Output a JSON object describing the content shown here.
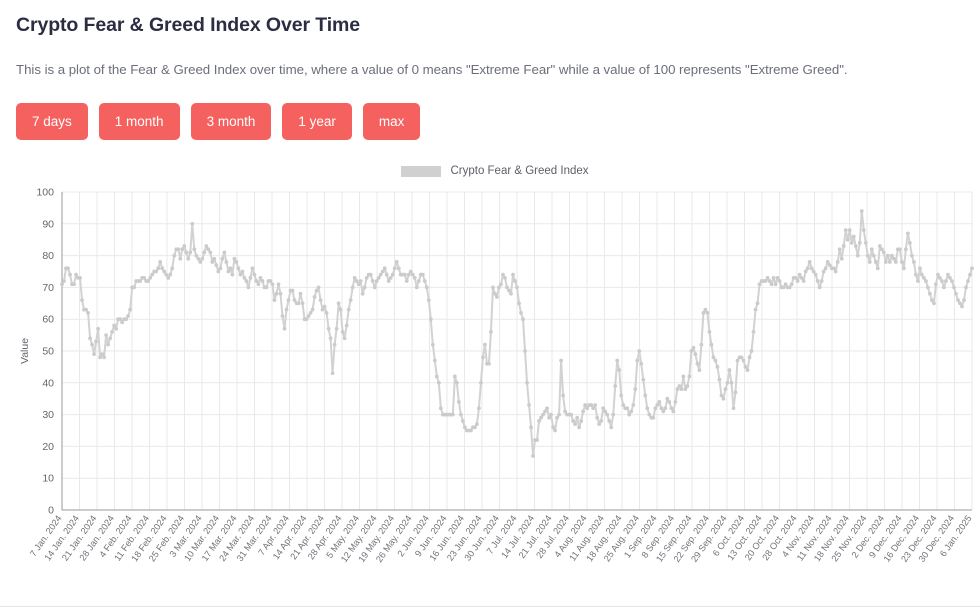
{
  "header": {
    "title": "Crypto Fear & Greed Index Over Time",
    "description": "This is a plot of the Fear & Greed Index over time, where a value of 0 means \"Extreme Fear\" while a value of 100 represents \"Extreme Greed\"."
  },
  "colors": {
    "button": "#f4615f",
    "button_text": "#ffffff",
    "series": "#d2d2d2",
    "grid": "#e9e9ea",
    "axis": "#9a9a9c",
    "title_text": "#2b2d42",
    "body_text": "#6b6f7b"
  },
  "range_buttons": [
    {
      "label": "7 days",
      "name": "range-7-days"
    },
    {
      "label": "1 month",
      "name": "range-1-month"
    },
    {
      "label": "3 month",
      "name": "range-3-month"
    },
    {
      "label": "1 year",
      "name": "range-1-year"
    },
    {
      "label": "max",
      "name": "range-max"
    }
  ],
  "chart_data": {
    "type": "line",
    "title": "",
    "xlabel": "",
    "ylabel": "Value",
    "ylim": [
      0,
      100
    ],
    "yticks": [
      0,
      10,
      20,
      30,
      40,
      50,
      60,
      70,
      80,
      90,
      100
    ],
    "grid": true,
    "legend": {
      "position": "top-center",
      "entries": [
        "Crypto Fear & Greed Index"
      ]
    },
    "series": [
      {
        "name": "Crypto Fear & Greed Index",
        "color": "#d2d2d2",
        "start_date": "7 Jan. 2024",
        "end_date": "6 Jan. 2025",
        "interval_days": 1,
        "values": [
          71,
          72,
          76,
          76,
          74,
          71,
          71,
          74,
          73,
          73,
          66,
          63,
          63,
          62,
          54,
          52,
          49,
          53,
          57,
          48,
          49,
          48,
          55,
          52,
          54,
          56,
          58,
          57,
          60,
          60,
          59,
          60,
          60,
          61,
          63,
          70,
          70,
          72,
          72,
          72,
          73,
          73,
          72,
          72,
          73,
          74,
          75,
          75,
          76,
          78,
          76,
          75,
          74,
          73,
          74,
          76,
          80,
          82,
          82,
          79,
          82,
          83,
          81,
          79,
          81,
          90,
          82,
          80,
          79,
          78,
          79,
          81,
          83,
          82,
          81,
          78,
          79,
          77,
          75,
          76,
          79,
          81,
          78,
          75,
          76,
          74,
          79,
          78,
          76,
          74,
          75,
          73,
          72,
          70,
          73,
          76,
          74,
          72,
          71,
          73,
          72,
          70,
          70,
          72,
          72,
          71,
          66,
          68,
          71,
          68,
          61,
          57,
          63,
          66,
          69,
          69,
          66,
          65,
          65,
          68,
          65,
          60,
          60,
          61,
          62,
          63,
          67,
          69,
          70,
          66,
          63,
          64,
          62,
          57,
          54,
          43,
          52,
          57,
          65,
          63,
          56,
          54,
          58,
          63,
          66,
          70,
          73,
          72,
          71,
          72,
          68,
          70,
          73,
          74,
          74,
          72,
          70,
          72,
          73,
          74,
          75,
          76,
          74,
          72,
          73,
          74,
          76,
          78,
          76,
          74,
          74,
          74,
          72,
          74,
          75,
          74,
          73,
          70,
          72,
          74,
          74,
          72,
          70,
          66,
          60,
          52,
          47,
          42,
          40,
          32,
          30,
          30,
          30,
          30,
          30,
          30,
          42,
          40,
          34,
          30,
          28,
          26,
          25,
          25,
          25,
          26,
          26,
          27,
          32,
          40,
          48,
          52,
          46,
          46,
          56,
          70,
          68,
          67,
          70,
          71,
          74,
          73,
          70,
          69,
          68,
          74,
          72,
          70,
          65,
          62,
          60,
          50,
          40,
          33,
          26,
          17,
          22,
          22,
          28,
          29,
          30,
          31,
          32,
          29,
          30,
          26,
          25,
          29,
          30,
          47,
          36,
          31,
          30,
          30,
          30,
          28,
          27,
          29,
          26,
          28,
          31,
          33,
          32,
          33,
          33,
          32,
          33,
          29,
          27,
          28,
          32,
          31,
          30,
          28,
          26,
          30,
          39,
          47,
          44,
          36,
          33,
          32,
          32,
          30,
          31,
          33,
          38,
          47,
          50,
          46,
          41,
          36,
          32,
          30,
          29,
          29,
          32,
          33,
          34,
          32,
          31,
          32,
          35,
          34,
          32,
          31,
          34,
          38,
          39,
          38,
          42,
          38,
          39,
          42,
          50,
          51,
          49,
          46,
          44,
          52,
          62,
          63,
          62,
          56,
          52,
          48,
          47,
          45,
          41,
          36,
          35,
          38,
          40,
          44,
          40,
          32,
          37,
          47,
          48,
          48,
          47,
          45,
          44,
          48,
          50,
          56,
          63,
          65,
          71,
          72,
          72,
          72,
          73,
          72,
          71,
          73,
          71,
          73,
          72,
          70,
          70,
          71,
          70,
          70,
          71,
          73,
          73,
          72,
          74,
          73,
          72,
          75,
          76,
          78,
          76,
          75,
          74,
          72,
          70,
          72,
          75,
          76,
          78,
          77,
          76,
          76,
          75,
          78,
          82,
          79,
          83,
          88,
          85,
          88,
          84,
          86,
          83,
          80,
          84,
          94,
          88,
          84,
          80,
          78,
          82,
          80,
          78,
          76,
          83,
          82,
          81,
          78,
          80,
          78,
          80,
          79,
          78,
          82,
          82,
          78,
          76,
          82,
          87,
          84,
          80,
          78,
          74,
          72,
          76,
          74,
          73,
          72,
          70,
          68,
          66,
          65,
          71,
          74,
          73,
          72,
          70,
          72,
          74,
          73,
          72,
          70,
          68,
          66,
          65,
          64,
          66,
          70,
          72,
          74,
          76
        ]
      }
    ],
    "xtick_labels": [
      "7 Jan. 2024",
      "14 Jan. 2024",
      "21 Jan. 2024",
      "28 Jan. 2024",
      "4 Feb. 2024",
      "11 Feb. 2024",
      "18 Feb. 2024",
      "25 Feb. 2024",
      "3 Mar. 2024",
      "10 Mar. 2024",
      "17 Mar. 2024",
      "24 Mar. 2024",
      "31 Mar. 2024",
      "7 Apr. 2024",
      "14 Apr. 2024",
      "21 Apr. 2024",
      "28 Apr. 2024",
      "5 May. 2024",
      "12 May. 2024",
      "19 May. 2024",
      "26 May. 2024",
      "2 Jun. 2024",
      "9 Jun. 2024",
      "16 Jun. 2024",
      "23 Jun. 2024",
      "30 Jun. 2024",
      "7 Jul. 2024",
      "14 Jul. 2024",
      "21 Jul. 2024",
      "28 Jul. 2024",
      "4 Aug. 2024",
      "11 Aug. 2024",
      "18 Aug. 2024",
      "25 Aug. 2024",
      "1 Sep. 2024",
      "8 Sep. 2024",
      "15 Sep. 2024",
      "22 Sep. 2024",
      "29 Sep. 2024",
      "6 Oct. 2024",
      "13 Oct. 2024",
      "20 Oct. 2024",
      "28 Oct. 2024",
      "4 Nov. 2024",
      "11 Nov. 2024",
      "18 Nov. 2024",
      "25 Nov. 2024",
      "2 Dec. 2024",
      "9 Dec. 2024",
      "16 Dec. 2024",
      "23 Dec. 2024",
      "30 Dec. 2024",
      "6 Jan. 2025"
    ]
  }
}
